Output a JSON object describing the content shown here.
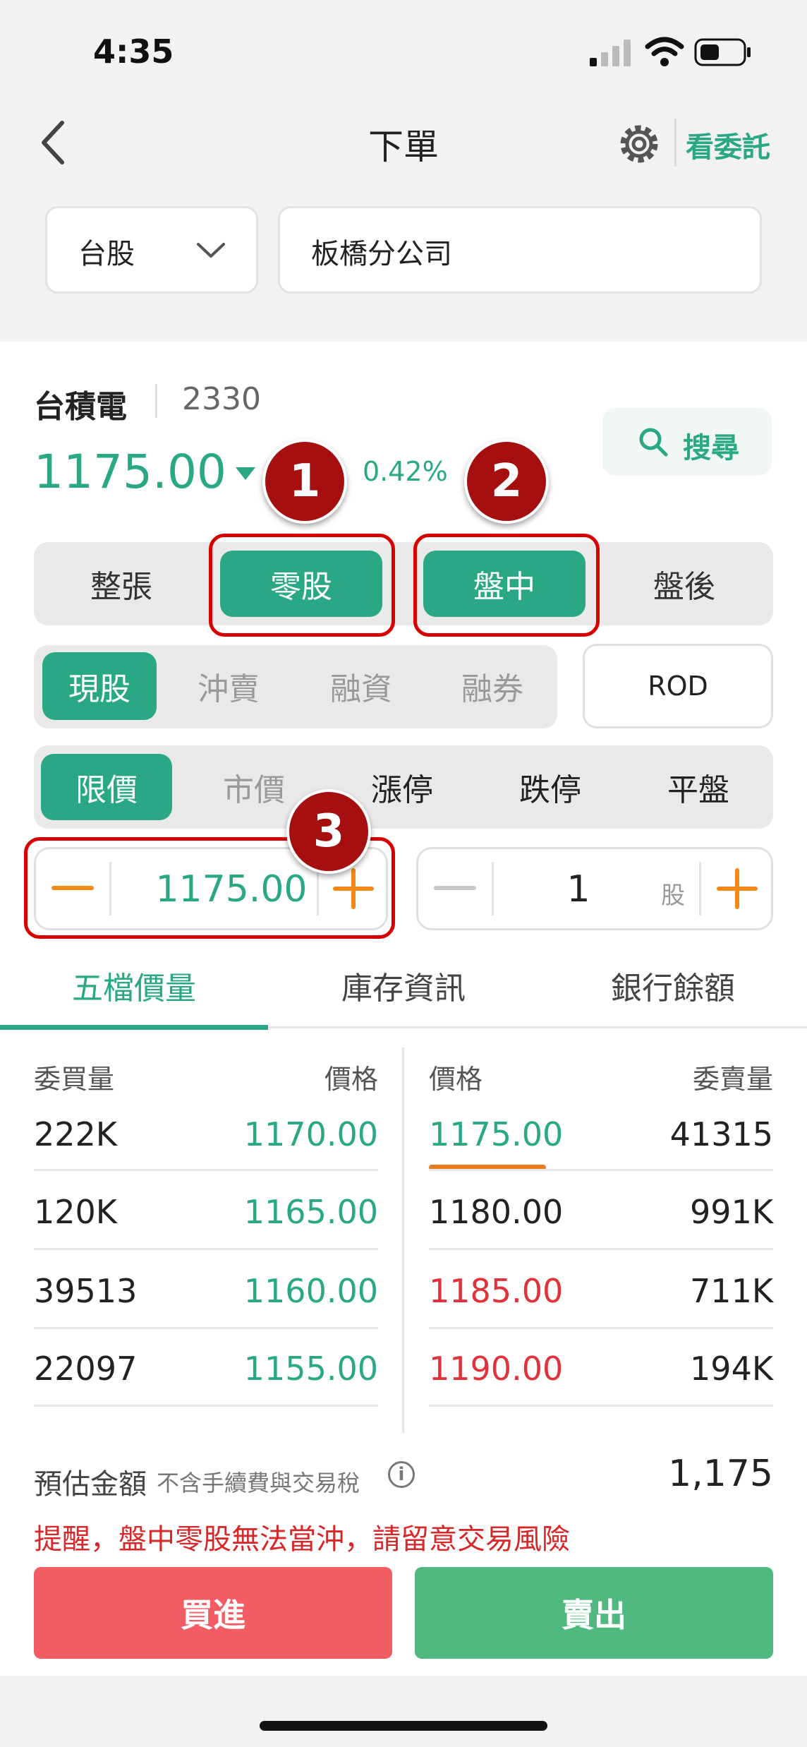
{
  "status": {
    "time": "4:35"
  },
  "nav": {
    "title": "下單",
    "link": "看委託"
  },
  "market_select": {
    "value": "台股"
  },
  "branch": {
    "value": "板橋分公司"
  },
  "stock": {
    "name": "台積電",
    "code": "2330",
    "price": "1175.00",
    "change": "0.42%",
    "search_label": "搜尋"
  },
  "lot_tabs": [
    "整張",
    "零股",
    "盤中",
    "盤後"
  ],
  "trade_types": [
    "現股",
    "沖賣",
    "融資",
    "融券"
  ],
  "time_in_force": "ROD",
  "price_types": [
    "限價",
    "市價",
    "漲停",
    "跌停",
    "平盤"
  ],
  "price_input": {
    "value": "1175.00"
  },
  "qty_input": {
    "value": "1",
    "unit": "股"
  },
  "info_tabs": [
    "五檔價量",
    "庫存資訊",
    "銀行餘額"
  ],
  "orderbook": {
    "bid_head_qty": "委買量",
    "bid_head_price": "價格",
    "ask_head_price": "價格",
    "ask_head_qty": "委賣量",
    "bids": [
      {
        "qty": "222K",
        "price": "1170.00"
      },
      {
        "qty": "120K",
        "price": "1165.00"
      },
      {
        "qty": "39513",
        "price": "1160.00"
      },
      {
        "qty": "22097",
        "price": "1155.00"
      }
    ],
    "asks": [
      {
        "price": "1175.00",
        "qty": "41315"
      },
      {
        "price": "1180.00",
        "qty": "991K"
      },
      {
        "price": "1185.00",
        "qty": "711K"
      },
      {
        "price": "1190.00",
        "qty": "194K"
      }
    ]
  },
  "estimate": {
    "label": "預估金額",
    "note": "不含手續費與交易稅",
    "value": "1,175"
  },
  "warning": "提醒，盤中零股無法當沖，請留意交易風險",
  "actions": {
    "buy": "買進",
    "sell": "賣出"
  },
  "annotations": [
    "1",
    "2",
    "3"
  ],
  "colors": {
    "accent": "#2aa886",
    "up": "#e0323a",
    "buy": "#f25c63",
    "sell": "#4fb97f",
    "annotation": "#d60000"
  }
}
